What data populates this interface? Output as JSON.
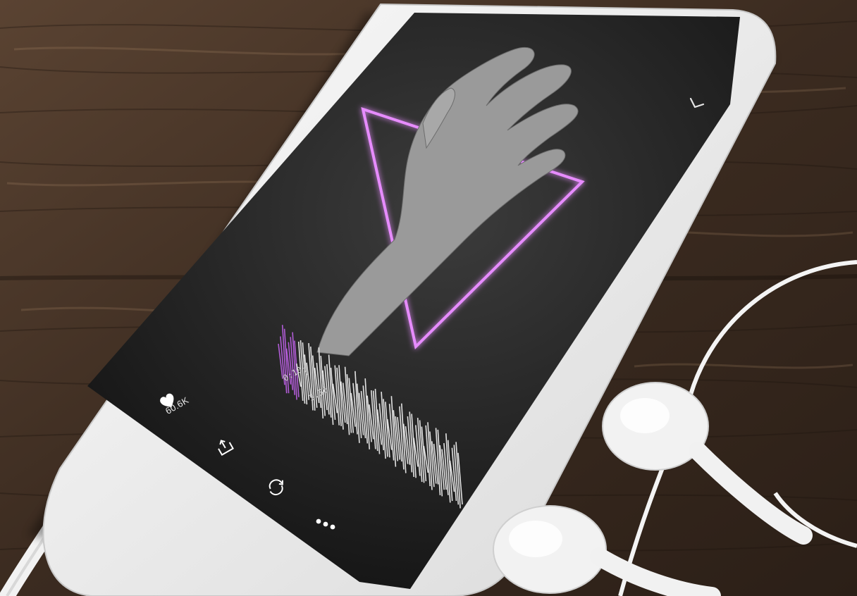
{
  "player": {
    "likes": "60.6K",
    "time_current": "0:10",
    "time_separator": "|",
    "time_total": "3:36",
    "progress_fraction": 0.05,
    "accent_color": "#b15cd6",
    "neon_color": "#e78cff"
  },
  "icons": {
    "collapse": "chevron-down-icon",
    "like": "heart-icon",
    "share": "share-icon",
    "repost": "repost-icon",
    "more": "more-dots-icon"
  }
}
